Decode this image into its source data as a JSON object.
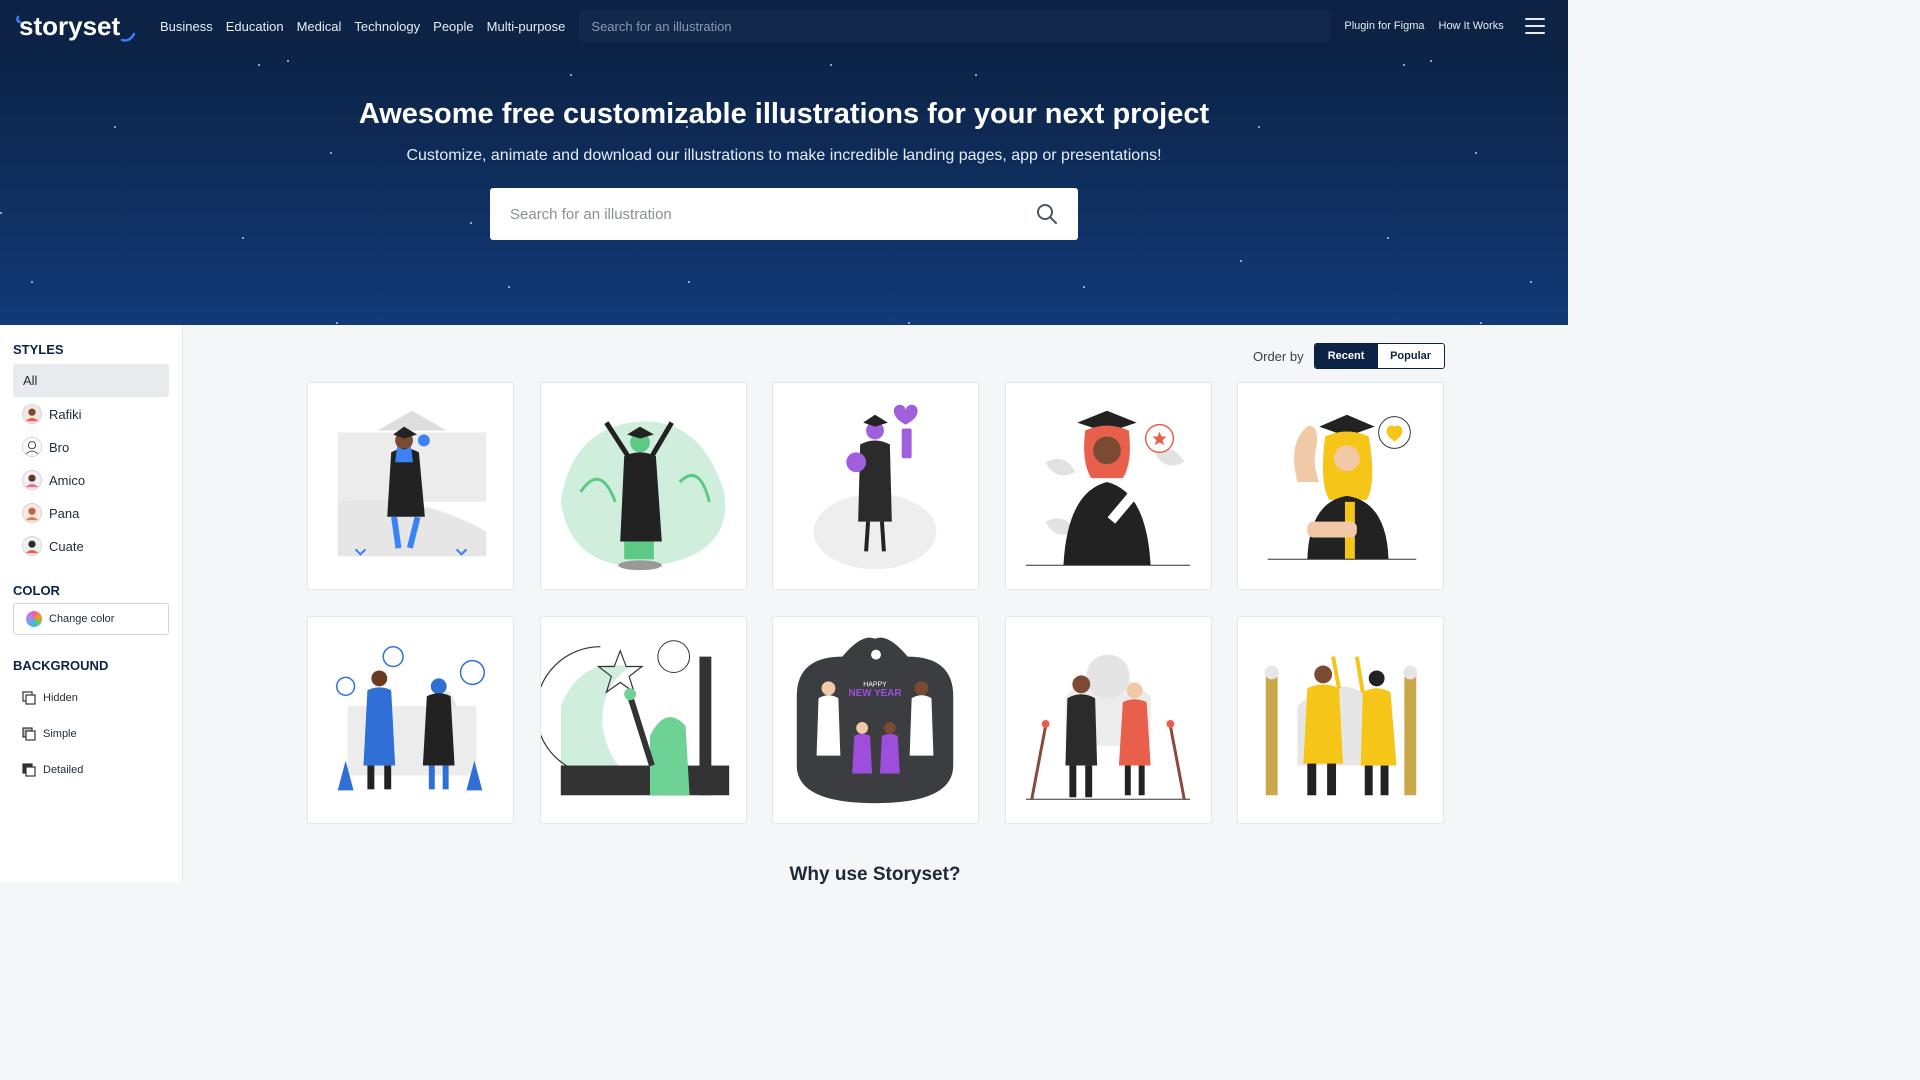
{
  "brand": {
    "logo_text": "storyset"
  },
  "nav": {
    "items": [
      "Business",
      "Education",
      "Medical",
      "Technology",
      "People",
      "Multi-purpose"
    ],
    "search_placeholder": "Search for an illustration",
    "links": [
      "Plugin for Figma",
      "How It Works"
    ]
  },
  "hero": {
    "title": "Awesome free customizable illustrations for your next project",
    "subtitle": "Customize, animate and download our illustrations to make incredible landing pages, app or presentations!",
    "search_placeholder": "Search for an illustration"
  },
  "sidebar": {
    "styles_heading": "STYLES",
    "styles": [
      "All",
      "Rafiki",
      "Bro",
      "Amico",
      "Pana",
      "Cuate"
    ],
    "color_heading": "COLOR",
    "change_color_label": "Change color",
    "background_heading": "BACKGROUND",
    "backgrounds": [
      "Hidden",
      "Simple",
      "Detailed"
    ]
  },
  "order": {
    "label": "Order by",
    "options": [
      "Recent",
      "Popular"
    ],
    "selected": "Recent"
  },
  "illustrations": [
    {
      "style": "graduation, blue accent",
      "accent": "#3b82f6"
    },
    {
      "style": "graduation, green accent",
      "accent": "#5cc985"
    },
    {
      "style": "graduation, purple accent",
      "accent": "#a05fdc"
    },
    {
      "style": "graduation, red accent",
      "accent": "#e8604c"
    },
    {
      "style": "graduation, yellow accent",
      "accent": "#f5c518"
    },
    {
      "style": "celebration, blue accent",
      "accent": "#2f6fd6"
    },
    {
      "style": "celebration, green accent",
      "accent": "#6ed294"
    },
    {
      "style": "Happy New Year, purple accent",
      "accent": "#9d4fdc",
      "text": "HAPPY NEW YEAR"
    },
    {
      "style": "celebration, red accent",
      "accent": "#e8604c"
    },
    {
      "style": "celebration, yellow accent",
      "accent": "#f5c518"
    }
  ],
  "footer_heading": "Why use Storyset?"
}
